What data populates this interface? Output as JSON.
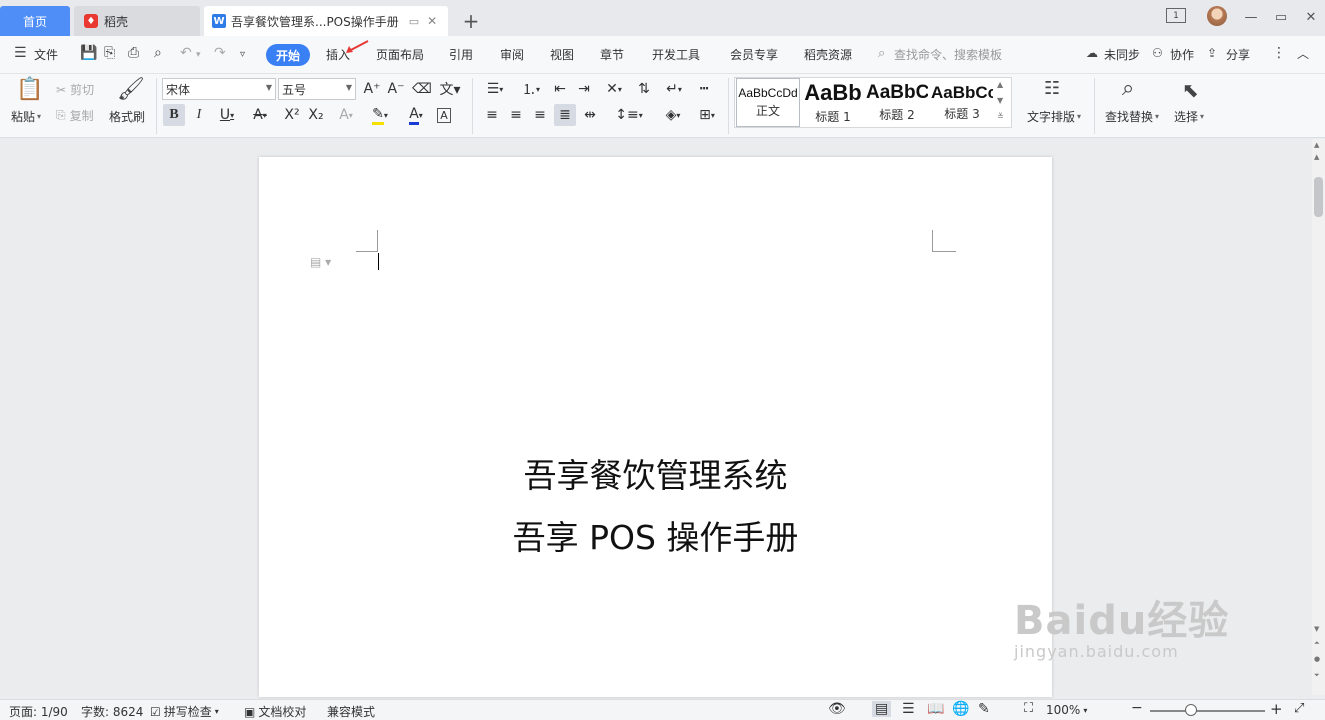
{
  "tabs": {
    "home": "首页",
    "daoke": "稻壳",
    "doc": "吾享餐饮管理系...POS操作手册",
    "new_tab": "+"
  },
  "window": {
    "page_badge": "1",
    "minimize": "—",
    "restore": "▭",
    "maximize": "□",
    "close": "✕"
  },
  "menu": {
    "file": "文件",
    "start": "开始",
    "insert": "插入",
    "layout": "页面布局",
    "references": "引用",
    "review": "审阅",
    "view": "视图",
    "section": "章节",
    "developer": "开发工具",
    "member": "会员专享",
    "resources": "稻壳资源",
    "search": "查找命令、搜索模板",
    "sync": "未同步",
    "collab": "协作",
    "share": "分享"
  },
  "ribbon": {
    "paste": "粘贴",
    "cut": "剪切",
    "copy": "复制",
    "format_painter": "格式刷",
    "font_name": "宋体",
    "font_size": "五号",
    "styles": [
      {
        "sample": "AaBbCcDd",
        "name": "正文"
      },
      {
        "sample": "AaBb",
        "name": "标题 1"
      },
      {
        "sample": "AaBbC",
        "name": "标题 2"
      },
      {
        "sample": "AaBbCc",
        "name": "标题 3"
      }
    ],
    "text_layout": "文字排版",
    "find_replace": "查找替换",
    "select": "选择"
  },
  "document": {
    "title_line1": "吾享餐饮管理系统",
    "title_line2": "吾享 POS 操作手册"
  },
  "status": {
    "page": "页面: 1/90",
    "word_count": "字数: 8624",
    "spell_check": "拼写检查",
    "doc_proof": "文档校对",
    "compat_mode": "兼容模式",
    "zoom": "100%"
  },
  "watermark": {
    "logo": "Baidu经验",
    "url": "jingyan.baidu.com"
  },
  "colors": {
    "accent": "#3a80f5",
    "highlight": "#f5e000",
    "font_color": "#1a3bd6",
    "wps_red": "#e8382f"
  }
}
